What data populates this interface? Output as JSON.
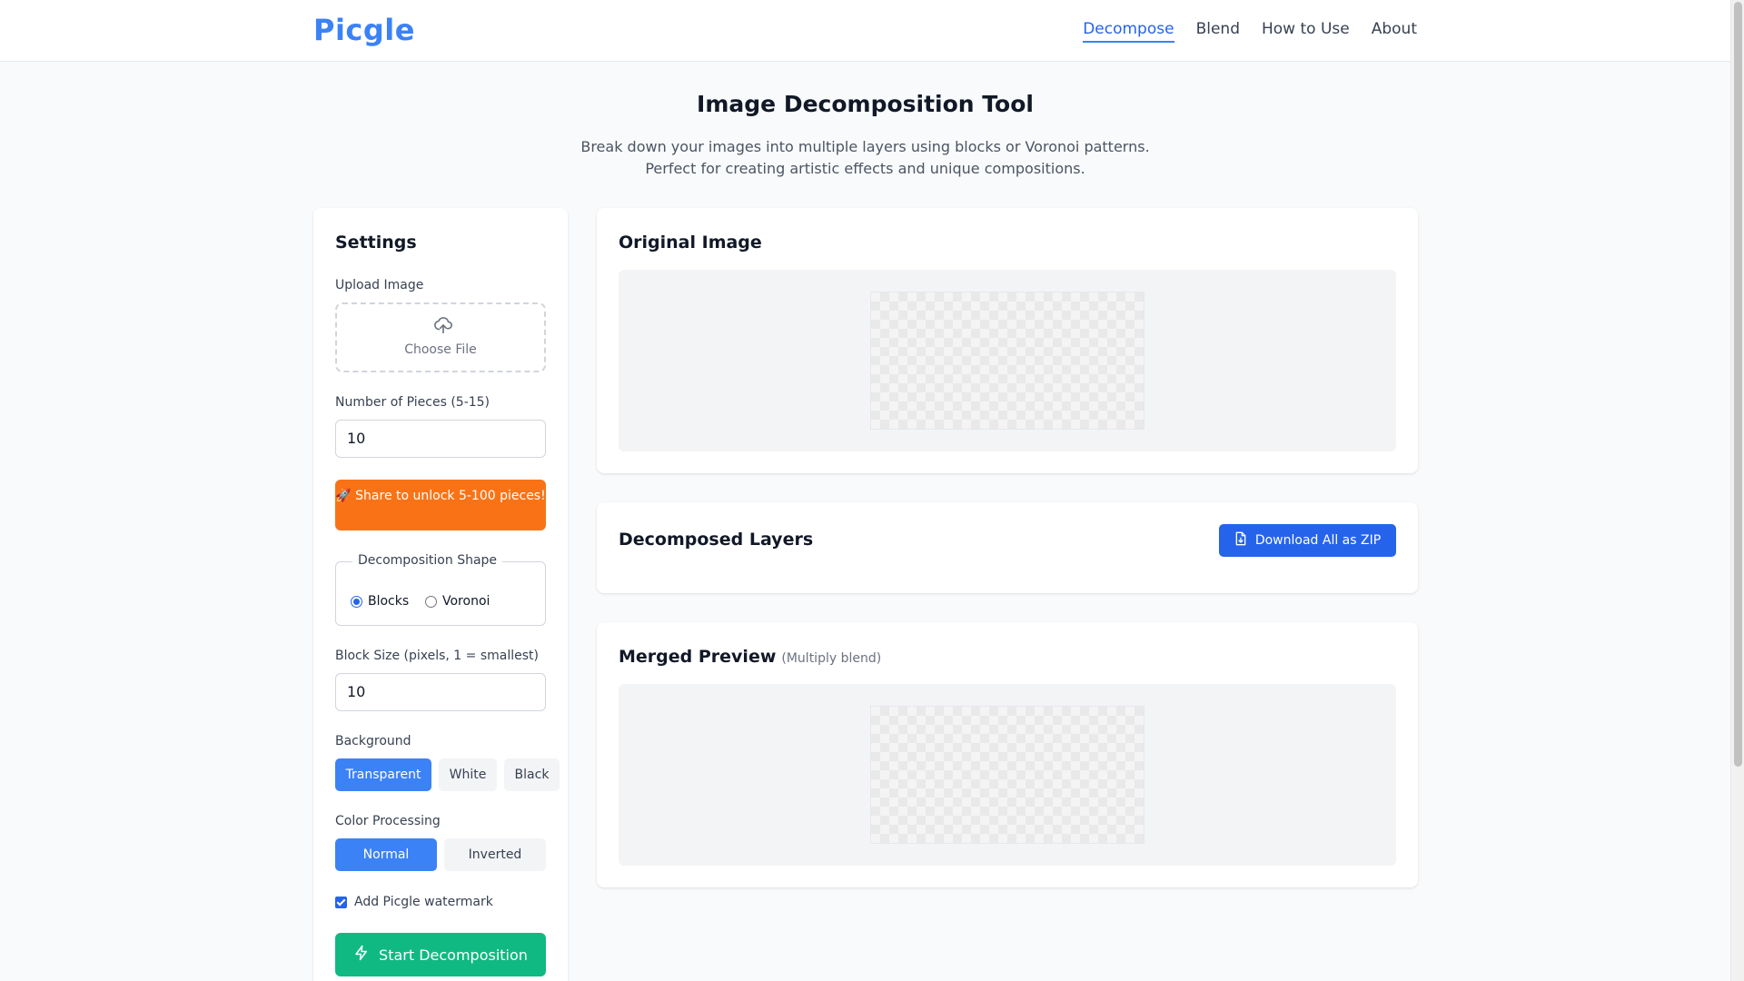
{
  "header": {
    "logo": "Picgle",
    "nav": [
      {
        "label": "Decompose",
        "active": true
      },
      {
        "label": "Blend",
        "active": false
      },
      {
        "label": "How to Use",
        "active": false
      },
      {
        "label": "About",
        "active": false
      }
    ]
  },
  "hero": {
    "title": "Image Decomposition Tool",
    "subtitle_line1": "Break down your images into multiple layers using blocks or Voronoi patterns.",
    "subtitle_line2": "Perfect for creating artistic effects and unique compositions."
  },
  "settings": {
    "title": "Settings",
    "upload_label": "Upload Image",
    "upload_button": "Choose File",
    "upload_icon": "cloud-upload-icon",
    "pieces_label": "Number of Pieces (5-15)",
    "pieces_value": "10",
    "share_button": "🚀 Share to unlock 5-100 pieces!",
    "shape_legend": "Decomposition Shape",
    "shape_options": [
      {
        "label": "Blocks",
        "selected": true
      },
      {
        "label": "Voronoi",
        "selected": false
      }
    ],
    "block_size_label": "Block Size (pixels, 1 = smallest)",
    "block_size_value": "10",
    "background_label": "Background",
    "background_options": [
      {
        "label": "Transparent",
        "selected": true
      },
      {
        "label": "White",
        "selected": false
      },
      {
        "label": "Black",
        "selected": false
      }
    ],
    "color_label": "Color Processing",
    "color_options": [
      {
        "label": "Normal",
        "selected": true
      },
      {
        "label": "Inverted",
        "selected": false
      }
    ],
    "watermark_label": "Add Picgle watermark",
    "watermark_checked": true,
    "start_button": "Start Decomposition",
    "start_icon": "lightning-icon"
  },
  "original": {
    "title": "Original Image"
  },
  "layers": {
    "title": "Decomposed Layers",
    "zip_button": "Download All as ZIP",
    "zip_icon": "file-download-icon"
  },
  "merged": {
    "title": "Merged Preview",
    "subtitle": "(Multiply blend)"
  },
  "colors": {
    "brand": "#3b82f6",
    "share": "#f97316",
    "start": "#10b981",
    "zip": "#2563eb"
  }
}
